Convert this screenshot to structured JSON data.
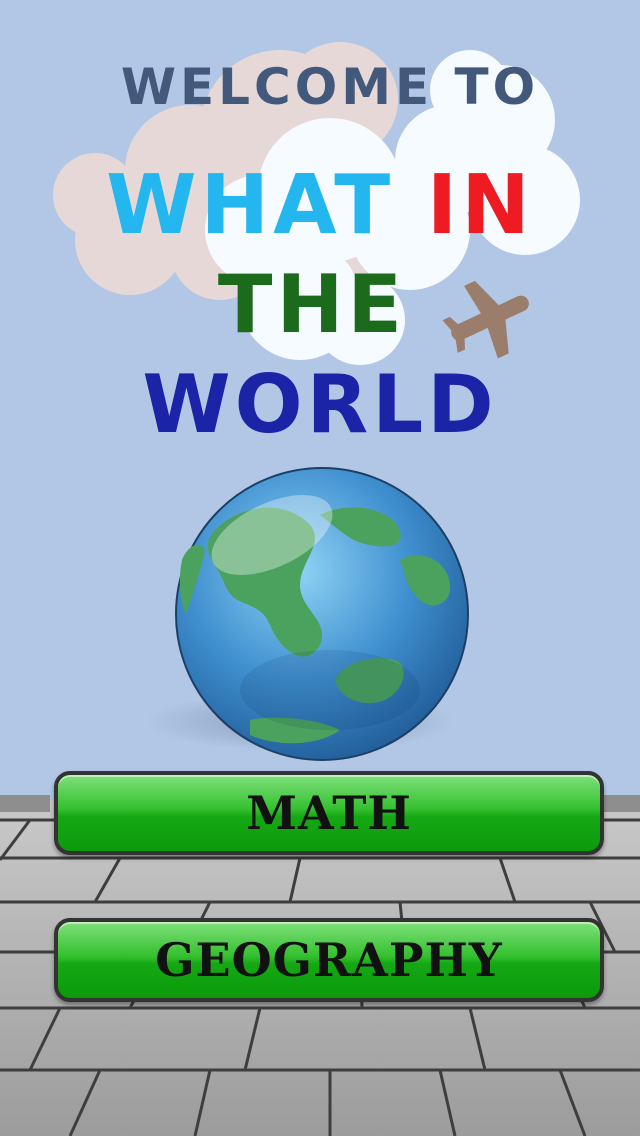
{
  "welcome_line": "WELCOME TO",
  "title_what": "WHAT",
  "title_in": "IN",
  "title_the": "THE",
  "title_world": "WORLD",
  "buttons": {
    "math": "MATH",
    "geography": "GEOGRAPHY"
  },
  "colors": {
    "sky": "#b2c6e6",
    "what": "#24b7ef",
    "in": "#ee1c22",
    "the": "#1c6b1c",
    "world": "#1b24a6",
    "button_green": "#16a814"
  }
}
